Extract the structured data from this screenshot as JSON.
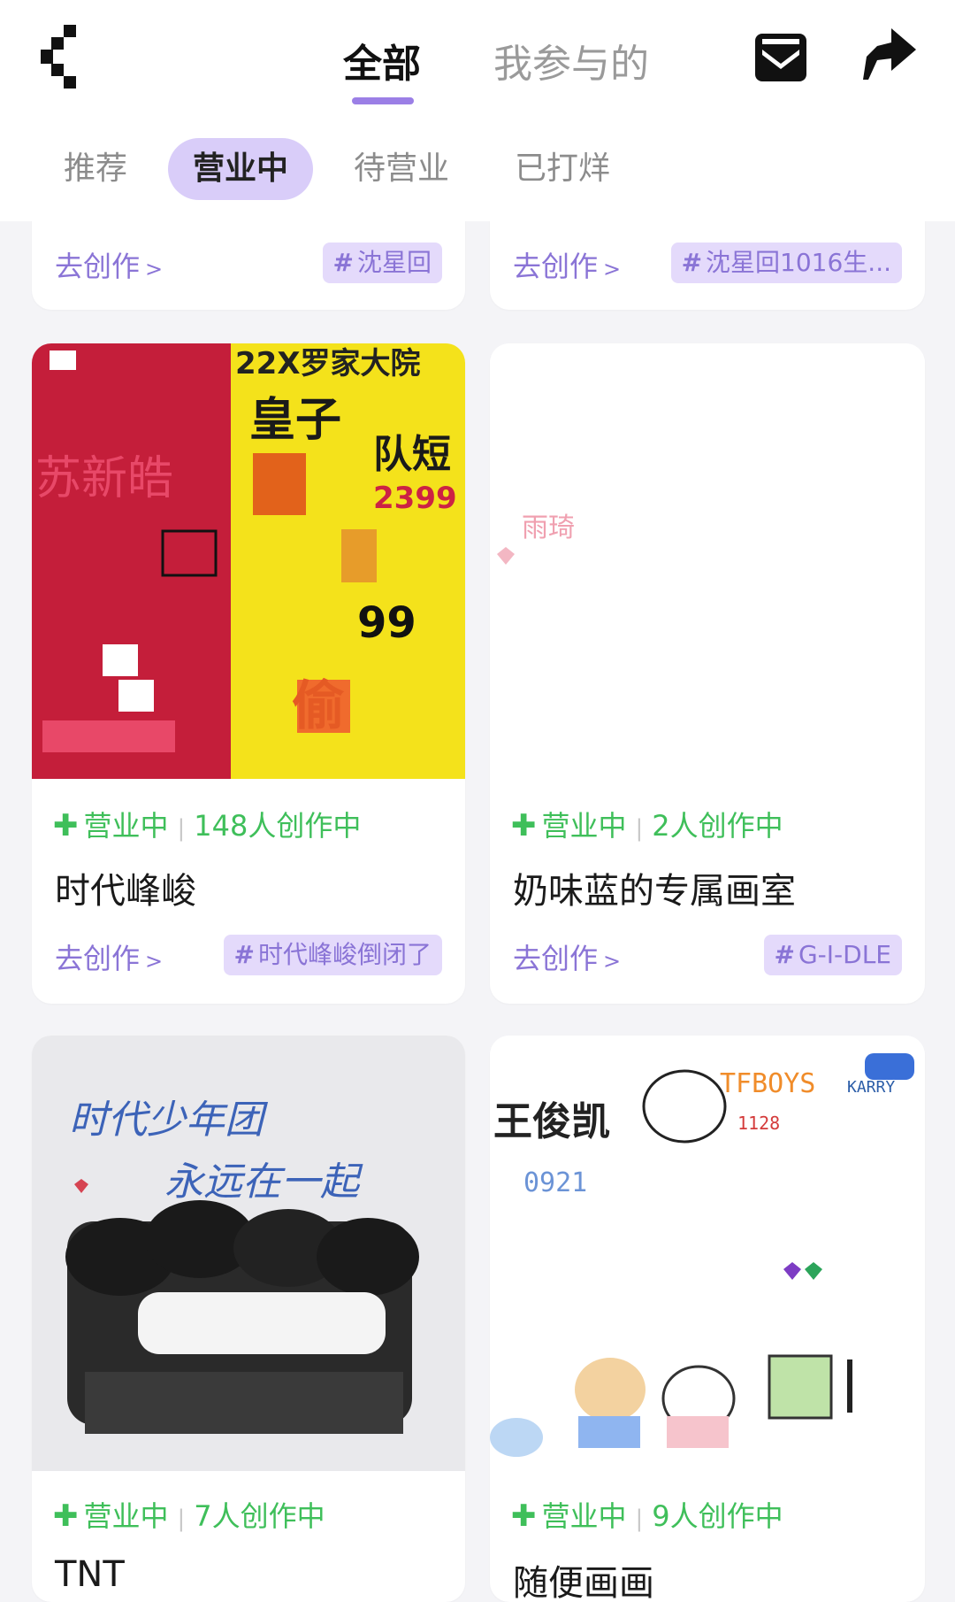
{
  "header": {
    "tabs": [
      {
        "label": "全部",
        "active": true
      },
      {
        "label": "我参与的",
        "active": false
      }
    ],
    "icons": {
      "back": "back-arrow-icon",
      "inbox": "inbox-icon",
      "share": "share-icon"
    },
    "accent": "#9b7fe6"
  },
  "filters": [
    {
      "label": "推荐",
      "active": false
    },
    {
      "label": "营业中",
      "active": true
    },
    {
      "label": "待营业",
      "active": false
    },
    {
      "label": "已打烊",
      "active": false
    }
  ],
  "partial_cards": [
    {
      "create_label": "去创作",
      "tag": "沈星回"
    },
    {
      "create_label": "去创作",
      "tag": "沈星回1016生..."
    }
  ],
  "cards": [
    {
      "status": "营业中",
      "participants": "148人创作中",
      "title": "时代峰峻",
      "create_label": "去创作",
      "tag": "时代峰峻倒闭了",
      "art_text": [
        "22X罗家大院",
        "皇子",
        "队短",
        "2399",
        "苏新皓",
        "偷",
        "99"
      ]
    },
    {
      "status": "营业中",
      "participants": "2人创作中",
      "title": "奶味蓝的专属画室",
      "create_label": "去创作",
      "tag": "G-I-DLE",
      "art_text": [
        "雨琦"
      ]
    },
    {
      "status": "营业中",
      "participants": "7人创作中",
      "title": "TNT",
      "art_text": [
        "时代少年团",
        "永远在一起"
      ]
    },
    {
      "status": "营业中",
      "participants": "9人创作中",
      "title": "随便画画",
      "art_text": [
        "王俊凯",
        "TFBOYS",
        "KARRY",
        "1128",
        "0921"
      ]
    }
  ],
  "colors": {
    "status_green": "#3fbf5a",
    "link_purple": "#8a74d6",
    "tag_bg": "#e4dafb"
  }
}
